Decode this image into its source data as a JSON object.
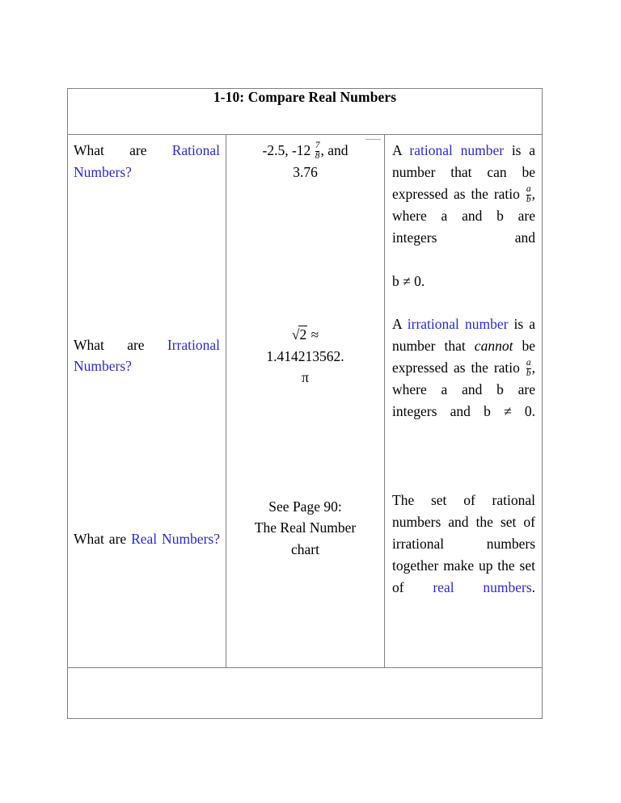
{
  "document": {
    "title": "1-10: Compare Real Numbers",
    "accent_color": "#2b2bc4",
    "text_color": "#000000",
    "border_color": "#808080"
  },
  "table": {
    "rows": [
      {
        "question": {
          "lead": "What are ",
          "term": "Rational Numbers",
          "tail": "?"
        },
        "examples": {
          "line1_pre": "-2.5, -12 ",
          "fraction": {
            "numerator": "7",
            "denominator": "8"
          },
          "line1_post": ", and",
          "line2": "3.76"
        },
        "definition": {
          "part1": "A ",
          "term": "rational number",
          "part2": " is a number that can be expressed as the ratio ",
          "fraction": {
            "numerator": "a",
            "denominator": "b"
          },
          "part3": ", where a and b are integers and",
          "part4": "b ≠ 0."
        }
      },
      {
        "question": {
          "lead": "What are ",
          "term": "Irrational Numbers",
          "tail": "?"
        },
        "examples": {
          "radical_index": "√",
          "radicand": "2",
          "approx_symbol": "≈",
          "line2": "1.414213562.",
          "line3": "π"
        },
        "definition": {
          "part1": "A ",
          "term": "irrational number",
          "part2": " is a number that ",
          "emphasis": "cannot",
          "part3": " be expressed as the ratio ",
          "fraction": {
            "numerator": "a",
            "denominator": "b"
          },
          "part4": ", where a and b are integers and b ≠ 0."
        }
      },
      {
        "question": {
          "lead": "What are ",
          "term": "Real Numbers",
          "tail": "?"
        },
        "examples": {
          "line1": "See Page 90:",
          "line2": "The Real Number",
          "line3": "chart"
        },
        "definition": {
          "part1": "The set of rational numbers and the set of irrational numbers together make up the set of ",
          "term": "real numbers",
          "part2": "."
        }
      }
    ],
    "footer_row": {
      "content": ""
    }
  }
}
